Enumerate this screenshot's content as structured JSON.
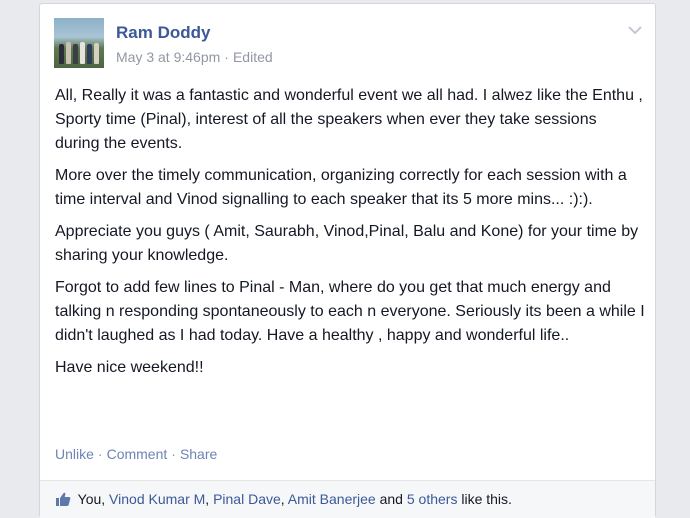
{
  "post": {
    "author": "Ram Doddy",
    "timestamp": "May 3 at 9:46pm",
    "meta_separator": "·",
    "edited_label": "Edited",
    "paragraphs": [
      "All, Really it was a fantastic and wonderful event we all had. I alwez like the Enthu , Sporty time (Pinal), interest of all the speakers when ever they take sessions during the events.",
      "More over the timely communication, organizing correctly for each session with a time interval and Vinod signalling to each speaker that its 5 more mins... :):).",
      "Appreciate you guys ( Amit, Saurabh, Vinod,Pinal, Balu and Kone) for your time by sharing your knowledge.",
      "Forgot to add few lines to Pinal - Man, where do you get that much energy and talking n responding spontaneously to each n everyone. Seriously its been a while I didn't laughed as I had today. Have a healthy , happy and wonderful life..",
      "Have nice weekend!!"
    ]
  },
  "actions": {
    "unlike": "Unlike",
    "comment": "Comment",
    "share": "Share",
    "separator": "·"
  },
  "likes": {
    "you": "You,",
    "person1": "Vinod Kumar M",
    "comma1": ",",
    "person2": "Pinal Dave",
    "comma2": ",",
    "person3": "Amit Banerjee",
    "and": "and",
    "others": "5 others",
    "suffix": "like this."
  },
  "colors": {
    "link": "#3b5998",
    "action_link": "#6d84b4",
    "muted": "#9197a3",
    "text": "#141823",
    "background": "#e9eaed"
  },
  "icons": {
    "chevron": "chevron-down-icon",
    "thumb": "thumbs-up-icon"
  }
}
